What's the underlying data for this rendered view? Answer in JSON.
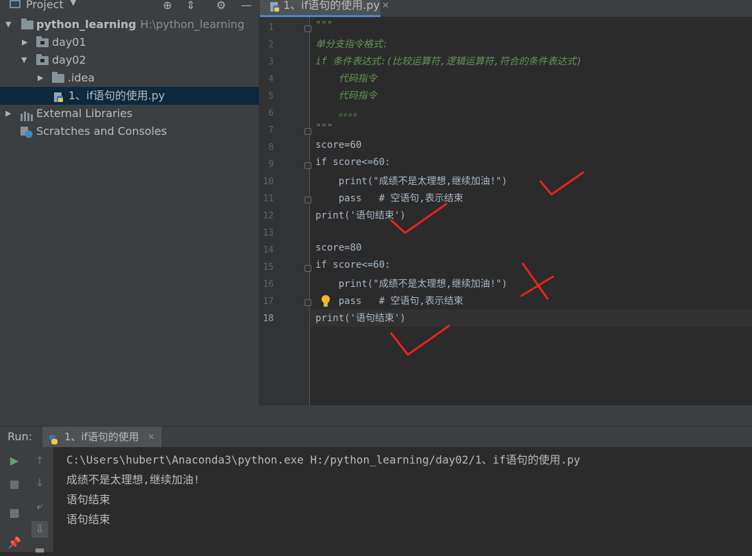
{
  "project_panel": {
    "title": "Project",
    "tree": [
      {
        "label": "python_learning",
        "path": "H:\\python_learning"
      },
      {
        "label": "day01"
      },
      {
        "label": "day02"
      },
      {
        "label": ".idea"
      },
      {
        "label": "1、if语句的使用.py"
      },
      {
        "label": "External Libraries"
      },
      {
        "label": "Scratches and Consoles"
      }
    ]
  },
  "editor": {
    "tab_label": "1、if语句的使用.py",
    "current_line": 18,
    "lines": [
      {
        "n": "1",
        "t": "\"\"\""
      },
      {
        "n": "2",
        "t": "单分支指令格式:"
      },
      {
        "n": "3",
        "t": "if 条件表达式:(比较运算符,逻辑运算符,符合的条件表达式)"
      },
      {
        "n": "4",
        "t": "    代码指令"
      },
      {
        "n": "5",
        "t": "    代码指令"
      },
      {
        "n": "6",
        "t": "    。。。。"
      },
      {
        "n": "7",
        "t": "\"\"\""
      },
      {
        "n": "8",
        "t": "score=60"
      },
      {
        "n": "9",
        "t": "if score<=60:"
      },
      {
        "n": "10",
        "t": "    print(\"成绩不是太理想,继续加油!\")"
      },
      {
        "n": "11",
        "t": "    pass   # 空语句,表示结束"
      },
      {
        "n": "12",
        "t": "print('语句结束')"
      },
      {
        "n": "13",
        "t": ""
      },
      {
        "n": "14",
        "t": "score=80"
      },
      {
        "n": "15",
        "t": "if score<=60:"
      },
      {
        "n": "16",
        "t": "    print(\"成绩不是太理想,继续加油!\")"
      },
      {
        "n": "17",
        "t": "    pass   # 空语句,表示结束"
      },
      {
        "n": "18",
        "t": "print('语句结束')"
      }
    ]
  },
  "run_panel": {
    "label": "Run:",
    "tab_label": "1、if语句的使用",
    "output": [
      "C:\\Users\\hubert\\Anaconda3\\python.exe H:/python_learning/day02/1、if语句的使用.py",
      "成绩不是太理想,继续加油!",
      "语句结束",
      "语句结束"
    ]
  },
  "colors": {
    "accent": "#4a88c7",
    "annotation": "#e8241e",
    "selection": "#0d293e"
  }
}
